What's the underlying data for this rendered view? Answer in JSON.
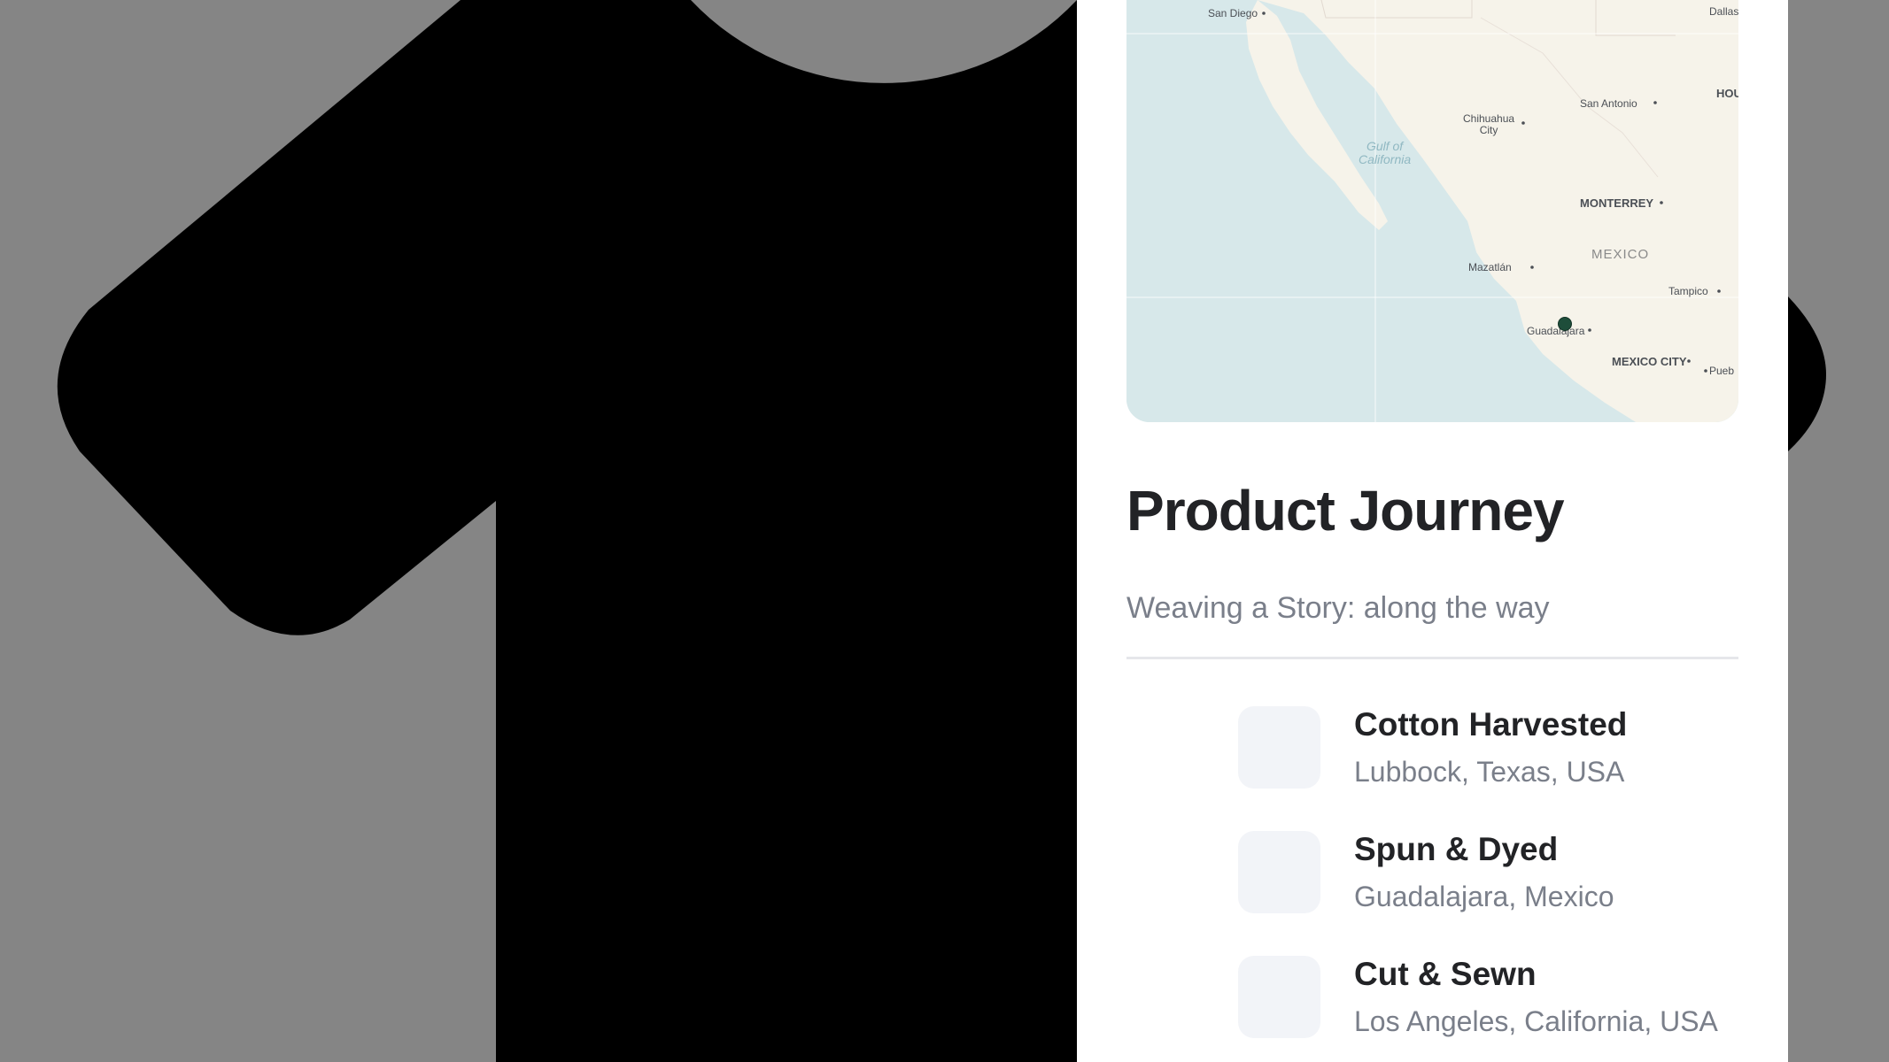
{
  "map": {
    "labels": {
      "san_diego": "San Diego",
      "dallas": "Dallas",
      "houston": "HOU",
      "san_antonio": "San Antonio",
      "chihuahua": "Chihuahua\nCity",
      "gulf": "Gulf of\nCalifornia",
      "monterrey": "MONTERREY",
      "mexico": "MEXICO",
      "mazatlan": "Mazatlán",
      "tampico": "Tampico",
      "guadalajara": "Guadalajara",
      "mexico_city": "MEXICO CITY",
      "puebla": "Pueb"
    },
    "pin_color": "#1e4d3a"
  },
  "journey": {
    "title": "Product Journey",
    "subtitle": "Weaving a Story: along the way",
    "steps": [
      {
        "title": "Cotton Harvested",
        "location": "Lubbock, Texas, USA"
      },
      {
        "title": "Spun & Dyed",
        "location": "Guadalajara, Mexico"
      },
      {
        "title": "Cut & Sewn",
        "location": "Los Angeles, California, USA"
      }
    ]
  },
  "colors": {
    "background": "#858585",
    "shirt": "#000000",
    "panel": "#ffffff",
    "water": "#d7e8ea",
    "land": "#f6f3ea"
  }
}
